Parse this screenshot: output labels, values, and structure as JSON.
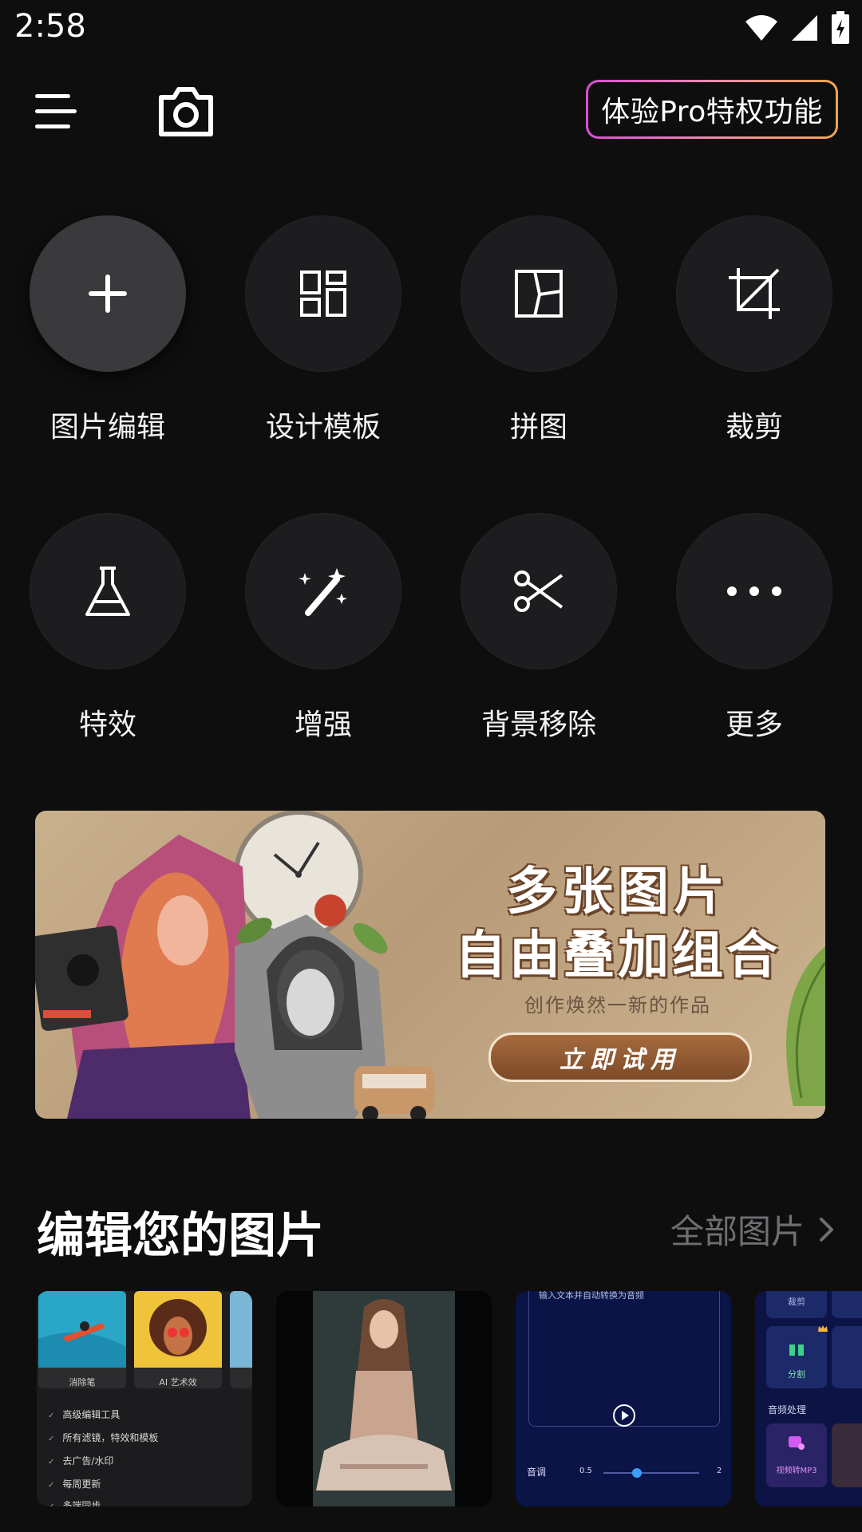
{
  "status": {
    "time": "2:58"
  },
  "header": {
    "pro_label": "体验Pro特权功能"
  },
  "tools": [
    {
      "label": "图片编辑",
      "icon": "plus-icon"
    },
    {
      "label": "设计模板",
      "icon": "template-icon"
    },
    {
      "label": "拼图",
      "icon": "collage-icon"
    },
    {
      "label": "裁剪",
      "icon": "crop-icon"
    },
    {
      "label": "特效",
      "icon": "flask-icon"
    },
    {
      "label": "增强",
      "icon": "magic-wand-icon"
    },
    {
      "label": "背景移除",
      "icon": "scissors-icon"
    },
    {
      "label": "更多",
      "icon": "more-dots-icon"
    }
  ],
  "banner": {
    "title_line1": "多张图片",
    "title_line2": "自由叠加组合",
    "subtitle": "创作焕然一新的作品",
    "cta": "立即试用"
  },
  "section": {
    "title": "编辑您的图片",
    "link": "全部图片"
  },
  "thumbs": {
    "t1": {
      "card1": "消除笔",
      "card2": "AI 艺术效",
      "features": [
        "高级编辑工具",
        "所有滤镜，特效和模板",
        "去广告/水印",
        "每周更新",
        "多端同步"
      ]
    },
    "t3": {
      "top_text": "输入文本并自动转换为音频",
      "label": "音调",
      "min": "0.5",
      "max": "2"
    },
    "t4": {
      "btn1": "裁剪",
      "btn2": "分割",
      "section": "音频处理",
      "btn3": "视频转MP3"
    }
  },
  "colors": {
    "background": "#0e0e0f",
    "tool_circle": "#1d1d20",
    "pro_gradient": [
      "#d94fd1",
      "#f6a24a"
    ],
    "muted_link": "#6f6f73"
  }
}
